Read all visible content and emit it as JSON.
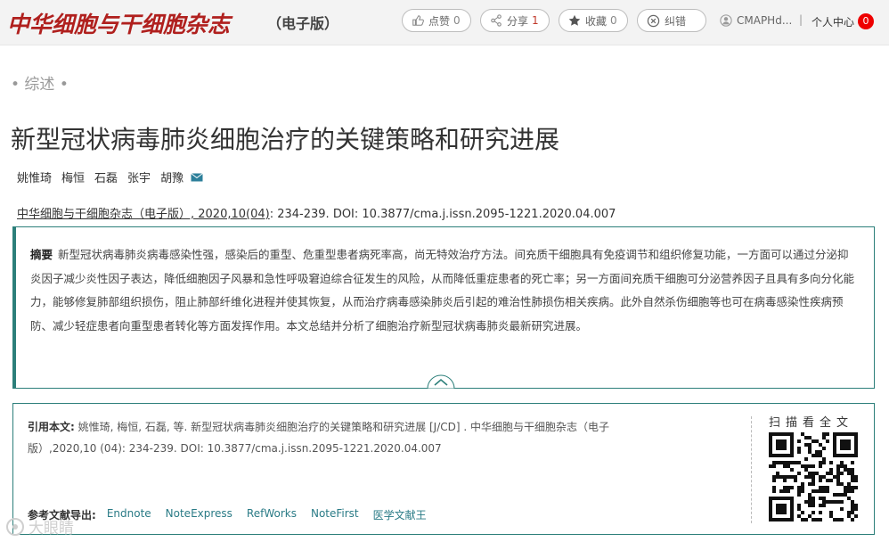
{
  "header": {
    "logo_text": "中华细胞与干细胞杂志",
    "logo_sub": "（电子版）",
    "actions": [
      {
        "label": "点赞",
        "count": "0"
      },
      {
        "label": "分享",
        "count": "1"
      },
      {
        "label": "收藏",
        "count": "0"
      },
      {
        "label": "纠错",
        "count": ""
      }
    ],
    "user_name": "CMAPHd...",
    "separator": "|",
    "user_center": "个人中心",
    "notification_count": "0"
  },
  "article": {
    "section": "• 综述 •",
    "title": "新型冠状病毒肺炎细胞治疗的关键策略和研究进展",
    "authors": [
      "姚惟琦",
      "梅恒",
      "石磊",
      "张宇",
      "胡豫"
    ],
    "journal_link": "中华细胞与干细胞杂志（电子版）, 2020,10(04)",
    "citation_rest": ": 234-239. DOI: 10.3877/cma.j.issn.2095-1221.2020.04.007"
  },
  "abstract": {
    "label": "摘要",
    "text": "新型冠状病毒肺炎病毒感染性强，感染后的重型、危重型患者病死率高，尚无特效治疗方法。间充质干细胞具有免疫调节和组织修复功能，一方面可以通过分泌抑炎因子减少炎性因子表达，降低细胞因子风暴和急性呼吸窘迫综合征发生的风险，从而降低重症患者的死亡率；另一方面间充质干细胞可分泌营养因子且具有多向分化能力，能够修复肺部组织损伤，阻止肺部纤维化进程并使其恢复，从而治疗病毒感染肺炎后引起的难治性肺损伤相关疾病。此外自然杀伤细胞等也可在病毒感染性疾病预防、减少轻症患者向重型患者转化等方面发挥作用。本文总结并分析了细胞治疗新型冠状病毒肺炎最新研究进展。"
  },
  "cite_box": {
    "label": "引用本文:",
    "text": "姚惟琦, 梅恒, 石磊, 等. 新型冠状病毒肺炎细胞治疗的关键策略和研究进展 [J/CD] . 中华细胞与干细胞杂志（电子版）,2020,10 (04): 234-239. DOI: 10.3877/cma.j.issn.2095-1221.2020.04.007",
    "export_label": "参考文献导出:",
    "export_links": [
      "Endnote",
      "NoteExpress",
      "RefWorks",
      "NoteFirst",
      "医学文献王"
    ],
    "qr_label": "扫描看全文"
  },
  "watermark": "大眼睛",
  "colors": {
    "accent": "#2c7f7a",
    "logo_red": "#b0201e",
    "link": "#2a7b86",
    "badge": "#e00000"
  }
}
